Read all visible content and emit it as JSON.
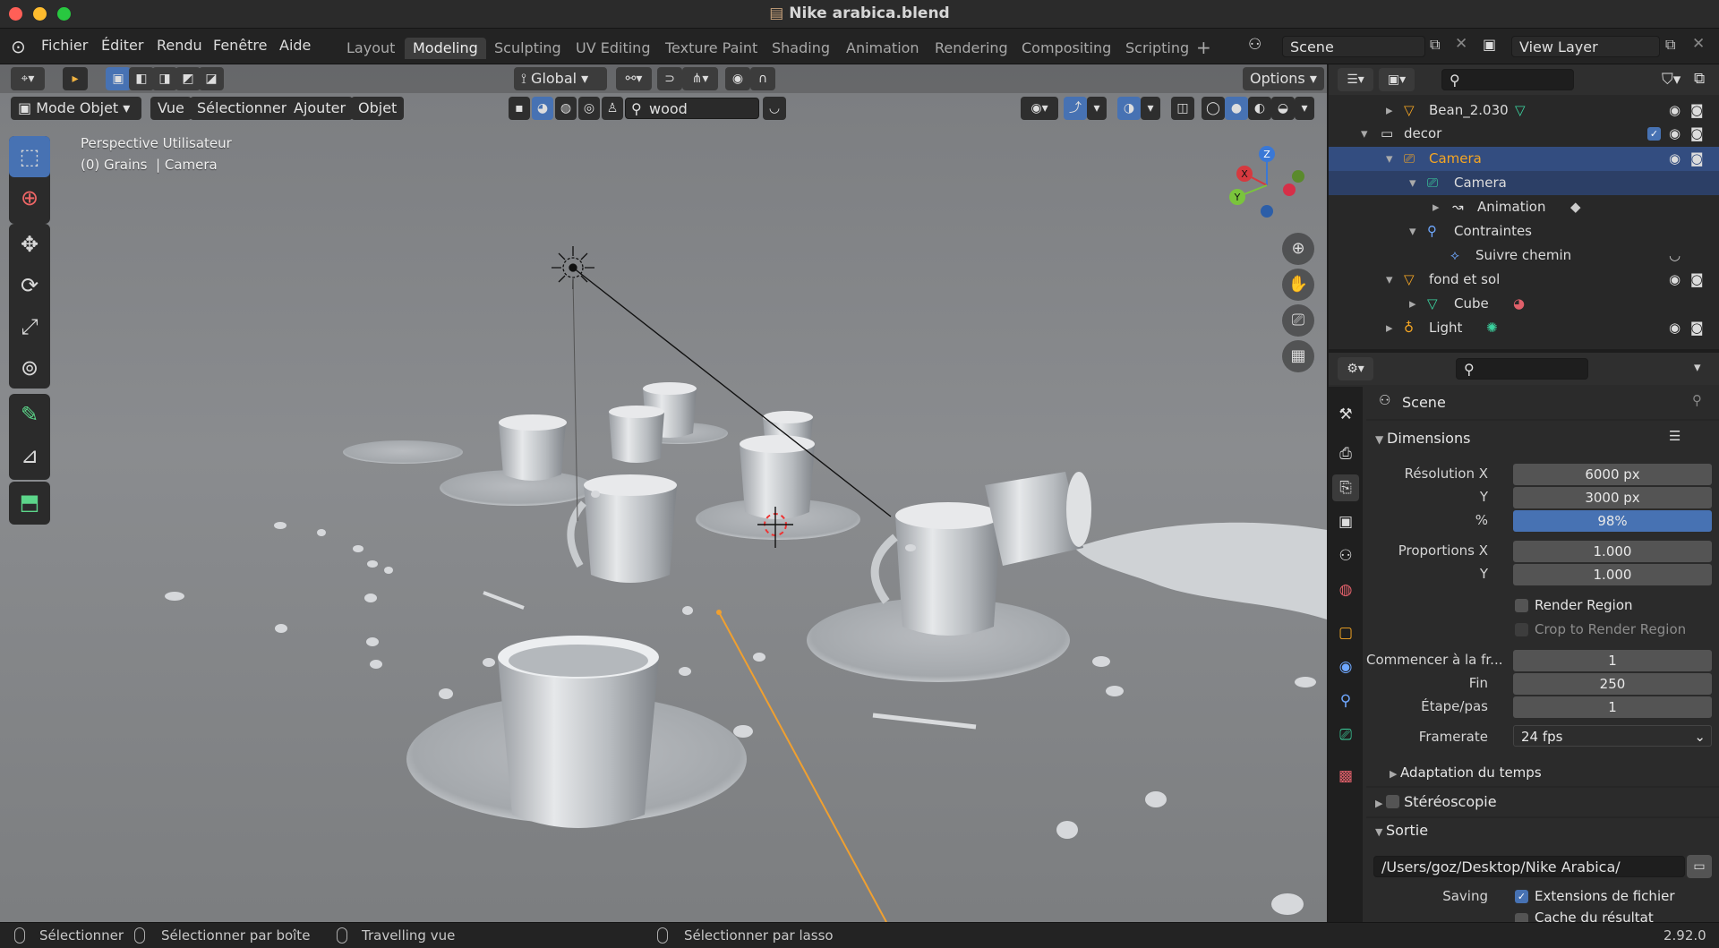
{
  "window": {
    "title": "Nike arabica.blend"
  },
  "menu": {
    "items": [
      "Fichier",
      "Éditer",
      "Rendu",
      "Fenêtre",
      "Aide"
    ]
  },
  "workspaces": {
    "tabs": [
      "Layout",
      "Modeling",
      "Sculpting",
      "UV Editing",
      "Texture Paint",
      "Shading",
      "Animation",
      "Rendering",
      "Compositing",
      "Scripting"
    ],
    "active": "Modeling"
  },
  "scene": {
    "name": "Scene",
    "view_layer": "View Layer"
  },
  "tool_header": {
    "orientation": "Global",
    "options_label": "Options"
  },
  "viewport_header": {
    "mode": "Mode Objet",
    "menus": [
      "Vue",
      "Sélectionner",
      "Ajouter",
      "Objet"
    ],
    "search_value": "wood"
  },
  "viewport": {
    "perspective": "Perspective Utilisateur",
    "context": "(0) Grains  | Camera",
    "gizmo": {
      "x": "X",
      "y": "Y",
      "z": "Z"
    }
  },
  "outliner": {
    "rows": [
      {
        "label": "Bean_2.030"
      },
      {
        "label": "decor"
      },
      {
        "label": "Camera"
      },
      {
        "label": "Camera"
      },
      {
        "label": "Animation"
      },
      {
        "label": "Contraintes"
      },
      {
        "label": "Suivre chemin"
      },
      {
        "label": "fond et sol"
      },
      {
        "label": "Cube"
      },
      {
        "label": "Light"
      }
    ]
  },
  "properties": {
    "context": "Scene",
    "dimensions": {
      "title": "Dimensions",
      "res_x_label": "Résolution X",
      "res_x": "6000 px",
      "res_y_label": "Y",
      "res_y": "3000 px",
      "pct_label": "%",
      "pct": "98%",
      "aspect_x_label": "Proportions X",
      "aspect_x": "1.000",
      "aspect_y_label": "Y",
      "aspect_y": "1.000",
      "render_region": "Render Region",
      "crop": "Crop to Render Region",
      "start_label": "Commencer à la fr...",
      "start": "1",
      "end_label": "Fin",
      "end": "250",
      "step_label": "Étape/pas",
      "step": "1",
      "fps_label": "Framerate",
      "fps": "24 fps",
      "time_remap": "Adaptation du temps"
    },
    "stereo": "Stéréoscopie",
    "output": {
      "title": "Sortie",
      "path": "/Users/goz/Desktop/Nike Arabica/",
      "saving_label": "Saving",
      "ext": "Extensions de fichier",
      "cache": "Cache du résultat"
    }
  },
  "status": {
    "select": "Sélectionner",
    "box": "Sélectionner par boîte",
    "pan": "Travelling vue",
    "lasso": "Sélectionner par lasso",
    "version": "2.92.0"
  },
  "colors": {
    "accent": "#4772b3",
    "camera_text": "#f5a623",
    "traffic_red": "#ff5f57",
    "traffic_yellow": "#febc2e",
    "traffic_green": "#28c840"
  }
}
